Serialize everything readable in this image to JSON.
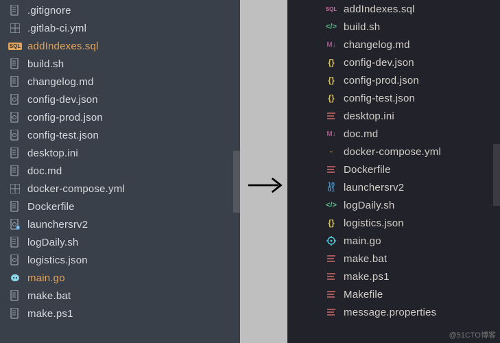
{
  "left": {
    "files": [
      {
        "name": ".gitignore",
        "icon": "doc",
        "color": "c-gray"
      },
      {
        "name": ".gitlab-ci.yml",
        "icon": "table",
        "color": "c-gray"
      },
      {
        "name": "addIndexes.sql",
        "icon": "sql",
        "color": "c-orange",
        "highlight": true
      },
      {
        "name": "build.sh",
        "icon": "doc",
        "color": "c-gray"
      },
      {
        "name": "changelog.md",
        "icon": "doc",
        "color": "c-gray"
      },
      {
        "name": "config-dev.json",
        "icon": "cfg",
        "color": "c-gray"
      },
      {
        "name": "config-prod.json",
        "icon": "cfg",
        "color": "c-gray"
      },
      {
        "name": "config-test.json",
        "icon": "cfg",
        "color": "c-gray"
      },
      {
        "name": "desktop.ini",
        "icon": "doc",
        "color": "c-gray"
      },
      {
        "name": "doc.md",
        "icon": "doc",
        "color": "c-gray"
      },
      {
        "name": "docker-compose.yml",
        "icon": "table",
        "color": "c-gray"
      },
      {
        "name": "Dockerfile",
        "icon": "doc",
        "color": "c-gray"
      },
      {
        "name": "launchersrv2",
        "icon": "cfg-q",
        "color": "c-gray"
      },
      {
        "name": "logDaily.sh",
        "icon": "doc",
        "color": "c-gray"
      },
      {
        "name": "logistics.json",
        "icon": "cfg",
        "color": "c-gray"
      },
      {
        "name": "main.go",
        "icon": "go",
        "color": "c-cyan",
        "highlight": true
      },
      {
        "name": "make.bat",
        "icon": "doc",
        "color": "c-gray"
      },
      {
        "name": "make.ps1",
        "icon": "doc",
        "color": "c-gray"
      }
    ]
  },
  "right": {
    "files": [
      {
        "name": "addIndexes.sql",
        "icon": "sql-badge",
        "color": "c-pink"
      },
      {
        "name": "build.sh",
        "icon": "code",
        "color": "c-green"
      },
      {
        "name": "changelog.md",
        "icon": "md",
        "color": "c-magenta"
      },
      {
        "name": "config-dev.json",
        "icon": "braces",
        "color": "c-yellow"
      },
      {
        "name": "config-prod.json",
        "icon": "braces",
        "color": "c-yellow"
      },
      {
        "name": "config-test.json",
        "icon": "braces",
        "color": "c-yellow"
      },
      {
        "name": "desktop.ini",
        "icon": "lines",
        "color": "c-red"
      },
      {
        "name": "doc.md",
        "icon": "md",
        "color": "c-magenta"
      },
      {
        "name": "docker-compose.yml",
        "icon": "yml",
        "color": "c-orange"
      },
      {
        "name": "Dockerfile",
        "icon": "lines",
        "color": "c-red"
      },
      {
        "name": "launchersrv2",
        "icon": "binary",
        "color": "c-blue"
      },
      {
        "name": "logDaily.sh",
        "icon": "code",
        "color": "c-green"
      },
      {
        "name": "logistics.json",
        "icon": "braces",
        "color": "c-yellow"
      },
      {
        "name": "main.go",
        "icon": "gear",
        "color": "c-cyan"
      },
      {
        "name": "make.bat",
        "icon": "lines",
        "color": "c-red"
      },
      {
        "name": "make.ps1",
        "icon": "lines",
        "color": "c-red"
      },
      {
        "name": "Makefile",
        "icon": "lines",
        "color": "c-red"
      },
      {
        "name": "message.properties",
        "icon": "lines",
        "color": "c-red"
      }
    ]
  },
  "watermark": "@51CTO博客"
}
